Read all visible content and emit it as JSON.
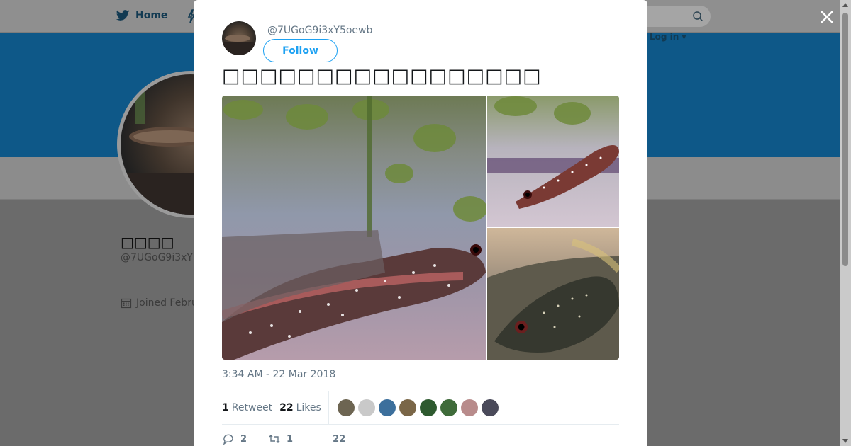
{
  "background": {
    "nav_home_label": "Home",
    "login_label": "Log in ▾",
    "profile_name": "□□□□",
    "profile_handle": "@7UGoG9i3xY",
    "joined_label": "Joined Febru"
  },
  "tweet": {
    "author_handle": "@7UGoG9i3xY5oewb",
    "follow_label": "Follow",
    "text": "□□□□□□□□□□□□□□□□□",
    "timestamp": "3:34 AM - 22 Mar 2018",
    "retweets_count": "1",
    "retweets_label": "Retweet",
    "likes_count": "22",
    "likes_label": "Likes",
    "replies_action_count": "2",
    "retweets_action_count": "1",
    "likes_action_count": "22",
    "liker_colors": [
      "#6d6552",
      "#c9c9c9",
      "#3c6f9c",
      "#7a6647",
      "#2e5a2f",
      "#3f6b3a",
      "#b88b8b",
      "#4a4a5a"
    ]
  },
  "colors": {
    "accent": "#1da1f2",
    "banner": "#0e5888"
  },
  "icons": [
    "twitter-bird-icon",
    "lightning-icon",
    "search-icon",
    "calendar-icon",
    "close-icon",
    "reply-icon",
    "retweet-icon",
    "heart-icon"
  ]
}
